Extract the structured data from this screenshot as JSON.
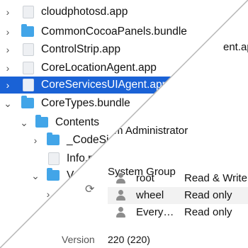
{
  "finder": {
    "rows": [
      {
        "label": "cloudphotosd.app",
        "chevron": "›",
        "icon": "app-doc"
      },
      {
        "label": "CommonCocoaPanels.bundle",
        "chevron": "›",
        "icon": "folder"
      },
      {
        "label": "ControlStrip.app",
        "chevron": "›",
        "icon": "app-doc"
      },
      {
        "label": "CoreLocationAgent.app",
        "chevron": "›",
        "icon": "app-doc"
      },
      {
        "label": "CoreServicesUIAgent.app",
        "chevron": "›",
        "icon": "app-doc",
        "selected": true
      },
      {
        "label": "CoreTypes.bundle",
        "chevron": "⌄",
        "icon": "folder"
      },
      {
        "label": "Contents",
        "chevron": "⌄",
        "icon": "folder"
      },
      {
        "label": "_CodeSignature",
        "chevron": "›",
        "icon": "folder"
      },
      {
        "label": "Info.plist",
        "chevron": "",
        "icon": "doc"
      },
      {
        "label": "Versions",
        "chevron": "⌄",
        "icon": "folder"
      }
    ],
    "partial_right_text": "ent.app"
  },
  "info": {
    "owner_partial": "stem Administrator",
    "group_label": "System Group",
    "permissions": [
      {
        "name": "root",
        "privilege": "Read & Write"
      },
      {
        "name": "wheel",
        "privilege": "Read only"
      },
      {
        "name": "Every…",
        "privilege": "Read only"
      }
    ],
    "version_label": "Version",
    "version_value": "220 (220)"
  }
}
